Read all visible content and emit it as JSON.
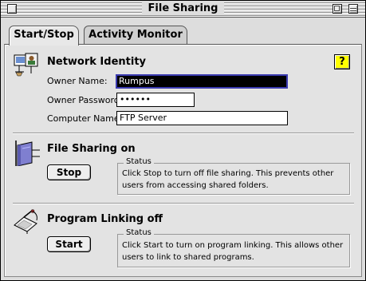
{
  "window": {
    "title": "File Sharing"
  },
  "tabs": [
    {
      "label": "Start/Stop",
      "active": true
    },
    {
      "label": "Activity Monitor",
      "active": false
    }
  ],
  "network_identity": {
    "title": "Network Identity",
    "icon": "network-identity-icon",
    "owner_name_label": "Owner Name:",
    "owner_name_value": "Rumpus",
    "owner_password_label": "Owner Password:",
    "owner_password_value": "••••••",
    "computer_name_label": "Computer Name:",
    "computer_name_value": "FTP Server",
    "help_label": "?"
  },
  "file_sharing": {
    "title": "File Sharing on",
    "icon": "shared-folder-icon",
    "button_label": "Stop",
    "status_title": "Status",
    "status_line1": "Click Stop to turn off file sharing. This prevents other",
    "status_line2": "users from accessing shared folders."
  },
  "program_linking": {
    "title": "Program Linking off",
    "icon": "program-linking-icon",
    "button_label": "Start",
    "status_title": "Status",
    "status_line1": "Click Start to turn on program linking. This allows other",
    "status_line2": "users to link to shared programs."
  },
  "colors": {
    "window_bg": "#dddddd",
    "help_button": "#ffff00",
    "selection_border": "#3b3bb0"
  }
}
